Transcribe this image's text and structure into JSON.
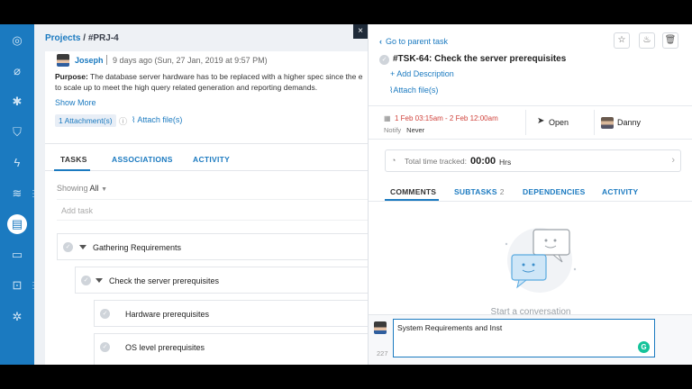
{
  "breadcrumb": {
    "projects": "Projects",
    "separator": " / ",
    "id": "#PRJ-4"
  },
  "post": {
    "author": "Joseph",
    "time": "9 days ago (Sun, 27 Jan, 2019 at 9:57 PM)",
    "purpose_label": "Purpose:",
    "purpose_line1": " The database server hardware has to be replaced with a higher spec since the e",
    "purpose_line2": "to scale up to meet the high query related generation and reporting demands.",
    "show_more": "Show More",
    "attachments": "1 Attachment(s)",
    "attach_file": "Attach file(s)"
  },
  "main_tabs": [
    "TASKS",
    "ASSOCIATIONS",
    "ACTIVITY"
  ],
  "filter": {
    "label": "Showing",
    "value": "All"
  },
  "add_task_placeholder": "Add task",
  "tasks": [
    "Gathering Requirements",
    "Check the server prerequisites",
    "Hardware prerequisites",
    "OS level prerequisites"
  ],
  "close_glyph": "×",
  "detail": {
    "go_parent": "Go to parent task",
    "task_title": "#TSK-64: Check the server prerequisites",
    "add_description": "+ Add Description",
    "attach_file": "Attach file(s)",
    "dates": "1 Feb 03:15am - 2 Feb 12:00am",
    "notify_label": "Notify",
    "notify_value": "Never",
    "status": "Open",
    "assignee": "Danny",
    "time_label": "Total time tracked:",
    "time_value": "00:00",
    "time_unit": "Hrs",
    "tabs": [
      {
        "label": "COMMENTS",
        "count": ""
      },
      {
        "label": "SUBTASKS",
        "count": "2"
      },
      {
        "label": "DEPENDENCIES",
        "count": ""
      },
      {
        "label": "ACTIVITY",
        "count": ""
      }
    ],
    "empty_state": "Start a conversation",
    "comment_value": "System Requirements and Inst",
    "char_count": "227",
    "grammarly_glyph": "G"
  },
  "colors": {
    "rail": "#1b7ac0",
    "link": "#1b7ac0",
    "date": "#d0433c",
    "grammarly": "#15c39a"
  },
  "icons": {
    "rail": [
      "dashboard-icon",
      "tag-icon",
      "bug-icon",
      "shield-icon",
      "lightning-icon",
      "layers-icon",
      "document-icon",
      "book-icon",
      "presentation-icon",
      "settings-icon"
    ],
    "detail_actions": [
      "star-icon",
      "flame-icon",
      "trash-icon"
    ]
  }
}
